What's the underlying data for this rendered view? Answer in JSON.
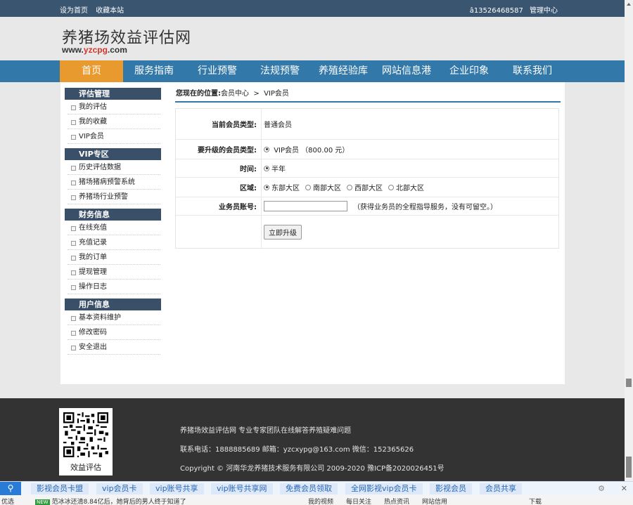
{
  "topbar": {
    "set_home": "设为首页",
    "bookmark": "收藏本站",
    "phone": "â13526468587",
    "admin": "管理中心"
  },
  "logo": {
    "title": "养猪场效益评估网",
    "url_prefix": "www.",
    "url_accent": "yzcpg",
    "url_suffix": ".com"
  },
  "nav": {
    "items": [
      {
        "label": "首页"
      },
      {
        "label": "服务指南"
      },
      {
        "label": "行业预警"
      },
      {
        "label": "法规预警"
      },
      {
        "label": "养殖经验库"
      },
      {
        "label": "网站信息港"
      },
      {
        "label": "企业印象"
      },
      {
        "label": "联系我们"
      }
    ]
  },
  "sidebar": {
    "groups": [
      {
        "title": "评估管理",
        "items": [
          "我的评估",
          "我的收藏",
          "VIP会员"
        ]
      },
      {
        "title": "VIP专区",
        "items": [
          "历史评估数据",
          "猪场猪病预警系统",
          "养猪场行业预警"
        ]
      },
      {
        "title": "财务信息",
        "items": [
          "在线充值",
          "充值记录",
          "我的订单",
          "提现管理",
          "操作日志"
        ]
      },
      {
        "title": "用户信息",
        "items": [
          "基本资料维护",
          "修改密码",
          "安全退出"
        ]
      }
    ]
  },
  "breadcrumb": {
    "prefix": "您现在的位置:",
    "level1": "会员中心",
    "sep": ">",
    "level2": "VIP会员"
  },
  "form": {
    "current_type_label": "当前会员类型:",
    "current_type_value": "普通会员",
    "upgrade_label": "要升级的会员类型:",
    "upgrade_option": "VIP会员 （800.00 元）",
    "time_label": "时间:",
    "time_option": "半年",
    "region_label": "区域:",
    "regions": [
      "东部大区",
      "南部大区",
      "西部大区",
      "北部大区"
    ],
    "agent_label": "业务员账号:",
    "agent_hint": "（获得业务员的全程指导服务，没有可留空。）",
    "submit_label": "立即升级"
  },
  "footer": {
    "qr_caption": "效益评估",
    "line1": "养猪场效益评估网 专业专家团队在线解答养殖疑难问题",
    "line2": "联系电话：1888885689 邮箱：yzcxypg@163.com 微信：152365626",
    "line3": "Copyright © 河南华龙养猪技术服务有限公司 2009-2020 豫ICP备2020026451号"
  },
  "adbar": {
    "items": [
      "影视会员卡盟",
      "vip会员卡",
      "vip账号共享",
      "vip账号共享网",
      "免费会员领取",
      "全网影视vip会员卡",
      "影视会员",
      "会员共享"
    ]
  },
  "statusbar": {
    "left": "优选",
    "badge": "NEW",
    "news": "范冰冰还清8.84亿后，她背后的男人终于知道了",
    "items": [
      "我的视频",
      "每日关注",
      "热点资讯",
      "网站信用",
      "下载"
    ]
  }
}
